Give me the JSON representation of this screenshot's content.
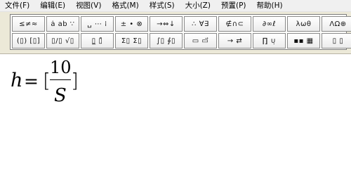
{
  "menu": [
    "文件(F)",
    "编辑(E)",
    "视图(V)",
    "格式(M)",
    "样式(S)",
    "大小(Z)",
    "预置(P)",
    "帮助(H)"
  ],
  "palette": {
    "row1": [
      "≤≠≈",
      "ȧ ab ∵",
      "␣ ⋯ ⁞",
      "± • ⊗",
      "→⇔↓",
      "∴ ∀∃",
      "∉∩⊂",
      "∂∞ℓ",
      "λωθ",
      "ΛΩ⊕"
    ],
    "row2": [
      "(▯) [▯]",
      "▯/▯ √▯",
      "▯̲ ▯̄",
      "Σ▯ Σ▯",
      "∫▯ ∮▯",
      "▭ ▭⃗",
      "→ ⇄",
      "∏̣ ∪̣",
      "▪▪ ▦",
      "▯ ▯"
    ]
  },
  "formula": {
    "lhs": "h",
    "equals": "=",
    "open_bracket": "[",
    "numerator": "10",
    "denominator": "S",
    "close_bracket": "]"
  }
}
